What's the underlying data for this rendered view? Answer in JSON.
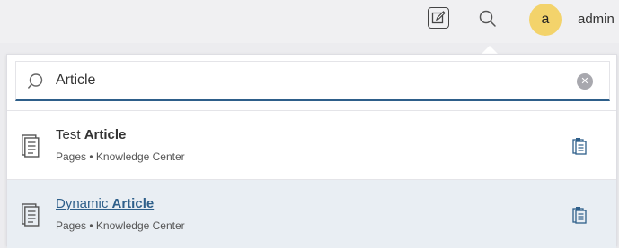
{
  "header": {
    "avatar_initial": "a",
    "user_name": "admin",
    "edit_icon": "edit-icon",
    "search_icon": "search-icon"
  },
  "search": {
    "value": "Article",
    "clear_icon": "clear-icon"
  },
  "results": [
    {
      "title_prefix": "Test ",
      "title_match": "Article",
      "type": "Pages",
      "separator": "•",
      "location": "Knowledge Center",
      "icon": "document-icon",
      "action_icon": "clipboard-icon",
      "highlighted": false
    },
    {
      "title_prefix": "Dynamic ",
      "title_match": "Article",
      "type": "Pages",
      "separator": "•",
      "location": "Knowledge Center",
      "icon": "document-icon",
      "action_icon": "clipboard-icon",
      "highlighted": true
    }
  ],
  "colors": {
    "accent": "#2e5f8a",
    "avatar_bg": "#f3d36b",
    "highlight_row": "#e9eef3"
  }
}
